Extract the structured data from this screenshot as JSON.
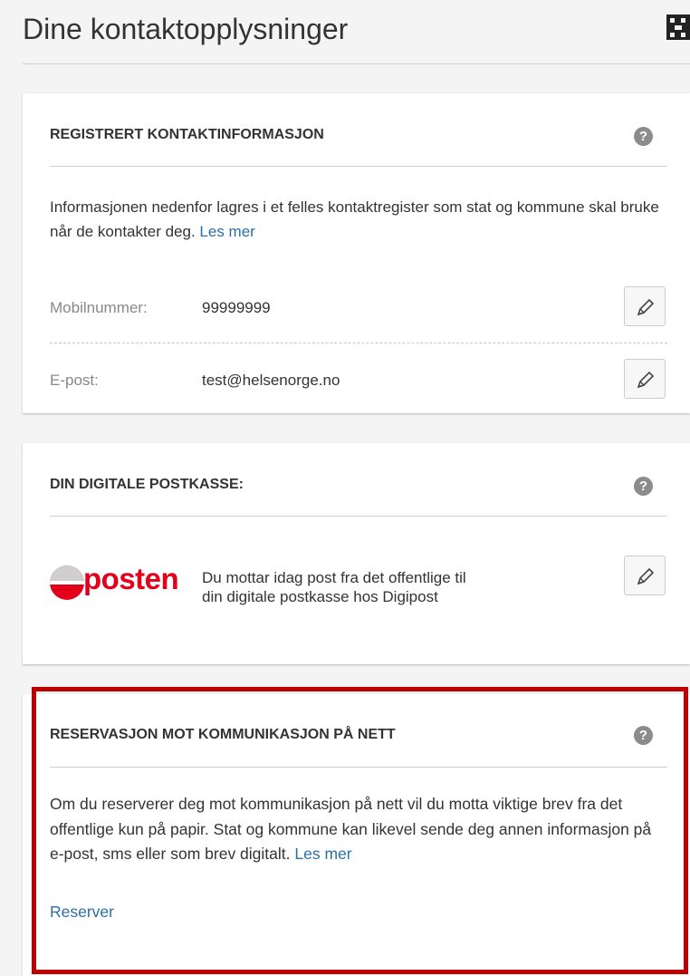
{
  "page": {
    "title": "Dine kontaktopplysninger"
  },
  "contact_card": {
    "heading": "REGISTRERT KONTAKTINFORMASJON",
    "help_symbol": "?",
    "intro": "Informasjonen nedenfor lagres i et felles kontaktregister som stat og kommune skal bruke når de kontakter deg.",
    "read_more": "Les mer",
    "mobile_label": "Mobilnummer:",
    "mobile_value": "99999999",
    "email_label": "E-post:",
    "email_value": "test@helsenorge.no"
  },
  "postbox_card": {
    "heading": "DIN DIGITALE POSTKASSE:",
    "help_symbol": "?",
    "logo_text": "posten",
    "description_line1": "Du mottar idag post fra det offentlige til",
    "description_line2": "din digitale postkasse hos Digipost"
  },
  "reservation_card": {
    "heading": "RESERVASJON MOT KOMMUNIKASJON PÅ NETT",
    "help_symbol": "?",
    "description": "Om du reserverer deg mot kommunikasjon på nett vil du motta viktige brev fra det offentlige kun på papir. Stat og kommune kan likevel sende deg annen informasjon på e-post, sms eller som brev digitalt.",
    "read_more": "Les mer",
    "reserve_link": "Reserver"
  },
  "colors": {
    "link": "#2a6fa8",
    "highlight": "#c00000",
    "posten_red": "#e3001b"
  }
}
